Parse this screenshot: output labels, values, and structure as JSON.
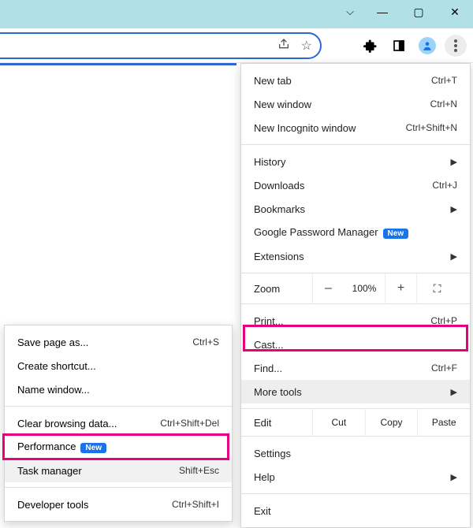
{
  "window_controls": {
    "dropdown": "⌵",
    "min": "—",
    "max": "▢",
    "close": "✕"
  },
  "toolbar": {
    "share_icon": "share-icon",
    "star_icon": "star-icon",
    "extensions_icon": "puzzle-icon",
    "sidepanel_icon": "panel-icon",
    "profile_icon": "profile-icon",
    "menu_icon": "kebab-icon"
  },
  "menu": {
    "new_tab": {
      "label": "New tab",
      "shortcut": "Ctrl+T"
    },
    "new_window": {
      "label": "New window",
      "shortcut": "Ctrl+N"
    },
    "new_incognito": {
      "label": "New Incognito window",
      "shortcut": "Ctrl+Shift+N"
    },
    "history": {
      "label": "History"
    },
    "downloads": {
      "label": "Downloads",
      "shortcut": "Ctrl+J"
    },
    "bookmarks": {
      "label": "Bookmarks"
    },
    "password_manager": {
      "label": "Google Password Manager",
      "badge": "New"
    },
    "extensions": {
      "label": "Extensions"
    },
    "zoom": {
      "label": "Zoom",
      "value": "100%",
      "minus": "–",
      "plus": "+"
    },
    "print": {
      "label": "Print...",
      "shortcut": "Ctrl+P"
    },
    "cast": {
      "label": "Cast..."
    },
    "find": {
      "label": "Find...",
      "shortcut": "Ctrl+F"
    },
    "more_tools": {
      "label": "More tools"
    },
    "edit": {
      "label": "Edit",
      "cut": "Cut",
      "copy": "Copy",
      "paste": "Paste"
    },
    "settings": {
      "label": "Settings"
    },
    "help": {
      "label": "Help"
    },
    "exit": {
      "label": "Exit"
    }
  },
  "submenu": {
    "save_page": {
      "label": "Save page as...",
      "shortcut": "Ctrl+S"
    },
    "create_shortcut": {
      "label": "Create shortcut..."
    },
    "name_window": {
      "label": "Name window..."
    },
    "clear_data": {
      "label": "Clear browsing data...",
      "shortcut": "Ctrl+Shift+Del"
    },
    "performance": {
      "label": "Performance",
      "badge": "New"
    },
    "task_manager": {
      "label": "Task manager",
      "shortcut": "Shift+Esc"
    },
    "dev_tools": {
      "label": "Developer tools",
      "shortcut": "Ctrl+Shift+I"
    }
  },
  "colors": {
    "highlight": "#e4007f",
    "accent": "#1a73e8",
    "titlebar": "#b2e0e7"
  }
}
